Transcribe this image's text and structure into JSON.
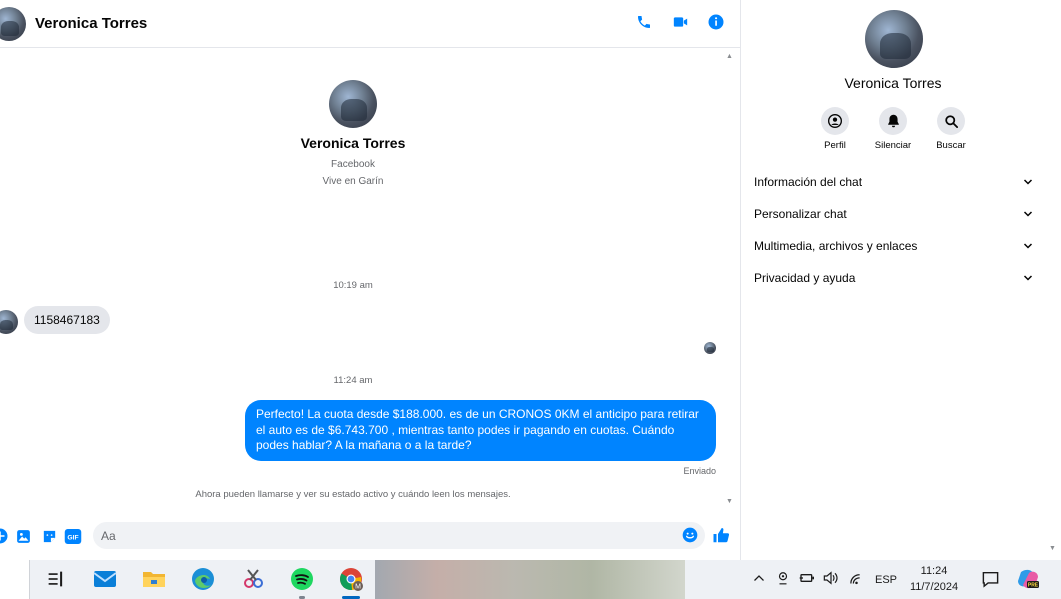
{
  "contact": {
    "name": "Veronica Torres"
  },
  "header": {
    "call_icon": "phone-icon",
    "video_icon": "video-camera-icon",
    "info_icon": "info-icon"
  },
  "intro": {
    "name": "Veronica Torres",
    "network": "Facebook",
    "location": "Vive en Garín"
  },
  "messages": {
    "time_1": "10:19 am",
    "incoming_1": "1158467183",
    "time_2": "11:24 am",
    "outgoing_1": "Perfecto! La cuota desde $188.000. es de un CRONOS 0KM el anticipo para retirar el auto es de $6.743.700 , mientras tanto podes ir pagando en cuotas. Cuándo podes hablar? A la mañana o a la tarde?",
    "sent_status": "Enviado",
    "notice": "Ahora pueden llamarse y ver su estado activo y cuándo leen los mensajes."
  },
  "composer": {
    "placeholder": "Aa",
    "gif_label": "GIF"
  },
  "side_panel": {
    "name": "Veronica Torres",
    "actions": [
      {
        "label": "Perfil",
        "icon": "profile-icon"
      },
      {
        "label": "Silenciar",
        "icon": "bell-icon"
      },
      {
        "label": "Buscar",
        "icon": "search-icon"
      }
    ],
    "sections": [
      "Información del chat",
      "Personalizar chat",
      "Multimedia, archivos y enlaces",
      "Privacidad y ayuda"
    ]
  },
  "taskbar": {
    "language": "ESP",
    "time": "11:24",
    "date": "11/7/2024"
  },
  "colors": {
    "accent": "#0084ff",
    "bubble_in": "#e4e6eb",
    "text_secondary": "#65676b"
  }
}
